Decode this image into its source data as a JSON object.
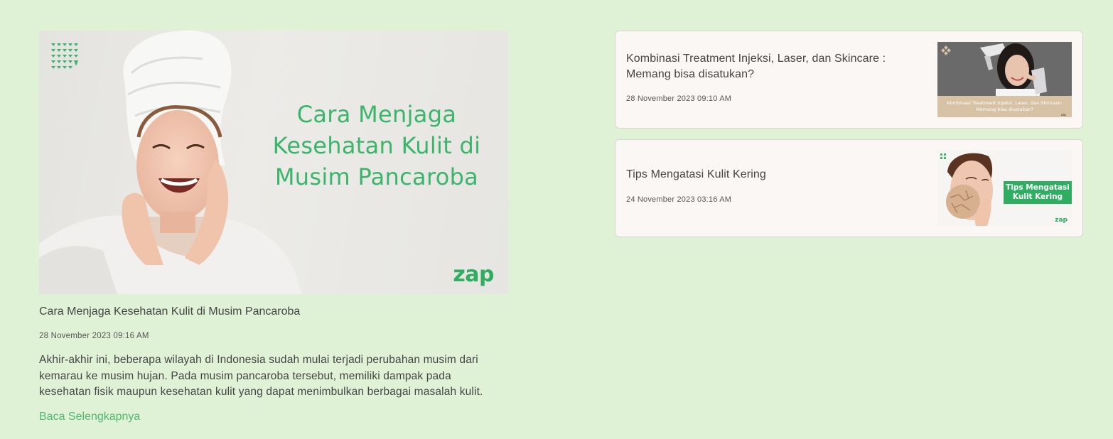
{
  "featured": {
    "image": {
      "headline": "Cara Menjaga Kesehatan Kulit di Musim Pancaroba",
      "logo": "zap"
    },
    "title": "Cara Menjaga Kesehatan Kulit di Musim Pancaroba",
    "date": "28 November 2023 09:16 AM",
    "excerpt": "Akhir-akhir ini, beberapa wilayah di Indonesia sudah mulai terjadi perubahan musim dari kemarau ke musim hujan. Pada musim pancaroba tersebut, memiliki dampak pada kesehatan fisik maupun kesehatan kulit yang dapat menimbulkan berbagai masalah kulit.",
    "read_more": "Baca Selengkapnya"
  },
  "articles": [
    {
      "title": "Kombinasi Treatment Injeksi, Laser, dan Skincare : Memang bisa disatukan?",
      "date": "28 November 2023 09:10 AM",
      "thumb_caption": "Kombinasi Treatment Injeksi, Laser, dan Skincare: Memang bisa disatukan?",
      "thumb_logo": "zap"
    },
    {
      "title": "Tips Mengatasi Kulit Kering",
      "date": "24 November 2023 03:16 AM",
      "thumb_caption": "Tips Mengatasi Kulit Kering",
      "thumb_logo": "zap"
    }
  ],
  "colors": {
    "page_background": "#e0f2d6",
    "card_background": "#faf7f4",
    "brand_green": "#2fae62",
    "link_green": "#4fb86d"
  }
}
